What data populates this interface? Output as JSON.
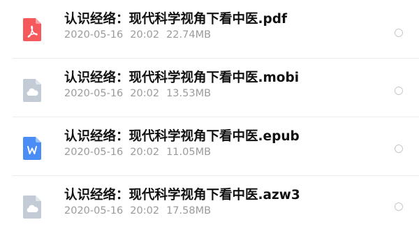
{
  "files": [
    {
      "name": "认识经络：现代科学视角下看中医.pdf",
      "date": "2020-05-16",
      "time": "20:02",
      "size": "22.74MB",
      "icon": "pdf-icon",
      "icon_color": "#f5595c"
    },
    {
      "name": "认识经络：现代科学视角下看中医.mobi",
      "date": "2020-05-16",
      "time": "20:02",
      "size": "13.53MB",
      "icon": "cloud-file-icon",
      "icon_color": "#c3ccd6"
    },
    {
      "name": "认识经络：现代科学视角下看中医.epub",
      "date": "2020-05-16",
      "time": "20:02",
      "size": "11.05MB",
      "icon": "word-doc-icon",
      "icon_color": "#4a8df6"
    },
    {
      "name": "认识经络：现代科学视角下看中医.azw3",
      "date": "2020-05-16",
      "time": "20:02",
      "size": "17.58MB",
      "icon": "cloud-file-icon",
      "icon_color": "#c3ccd6"
    }
  ]
}
